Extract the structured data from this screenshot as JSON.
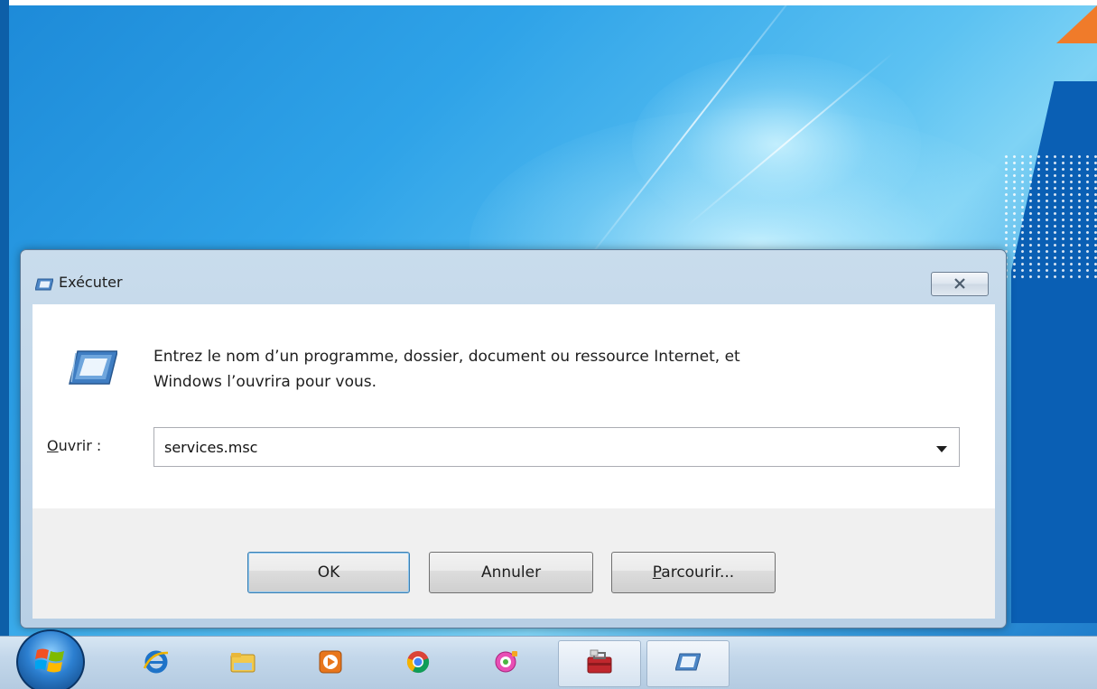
{
  "dialog": {
    "title": "Exécuter",
    "instruction_line1": "Entrez le nom d’un programme, dossier, document ou ressource Internet, et",
    "instruction_line2": "Windows l’ouvrira pour vous.",
    "open_label_accel": "O",
    "open_label_rest": "uvrir :",
    "open_value": "services.msc",
    "ok_label": "OK",
    "cancel_label": "Annuler",
    "browse_label_accel": "P",
    "browse_label_rest": "arcourir..."
  },
  "taskbar": {
    "items": [
      {
        "name": "internet-explorer",
        "icon": "internet-explorer-icon"
      },
      {
        "name": "file-explorer",
        "icon": "folder-icon"
      },
      {
        "name": "media-player",
        "icon": "media-player-icon"
      },
      {
        "name": "chrome",
        "icon": "chrome-icon"
      },
      {
        "name": "app-pink",
        "icon": "pink-app-icon"
      },
      {
        "name": "toolbox",
        "icon": "toolbox-icon"
      },
      {
        "name": "run",
        "icon": "run-icon"
      }
    ]
  },
  "colors": {
    "accent": "#3c7fb1",
    "desktop": "#2fa3e8",
    "wallpaper_orange": "#f07b2a"
  }
}
